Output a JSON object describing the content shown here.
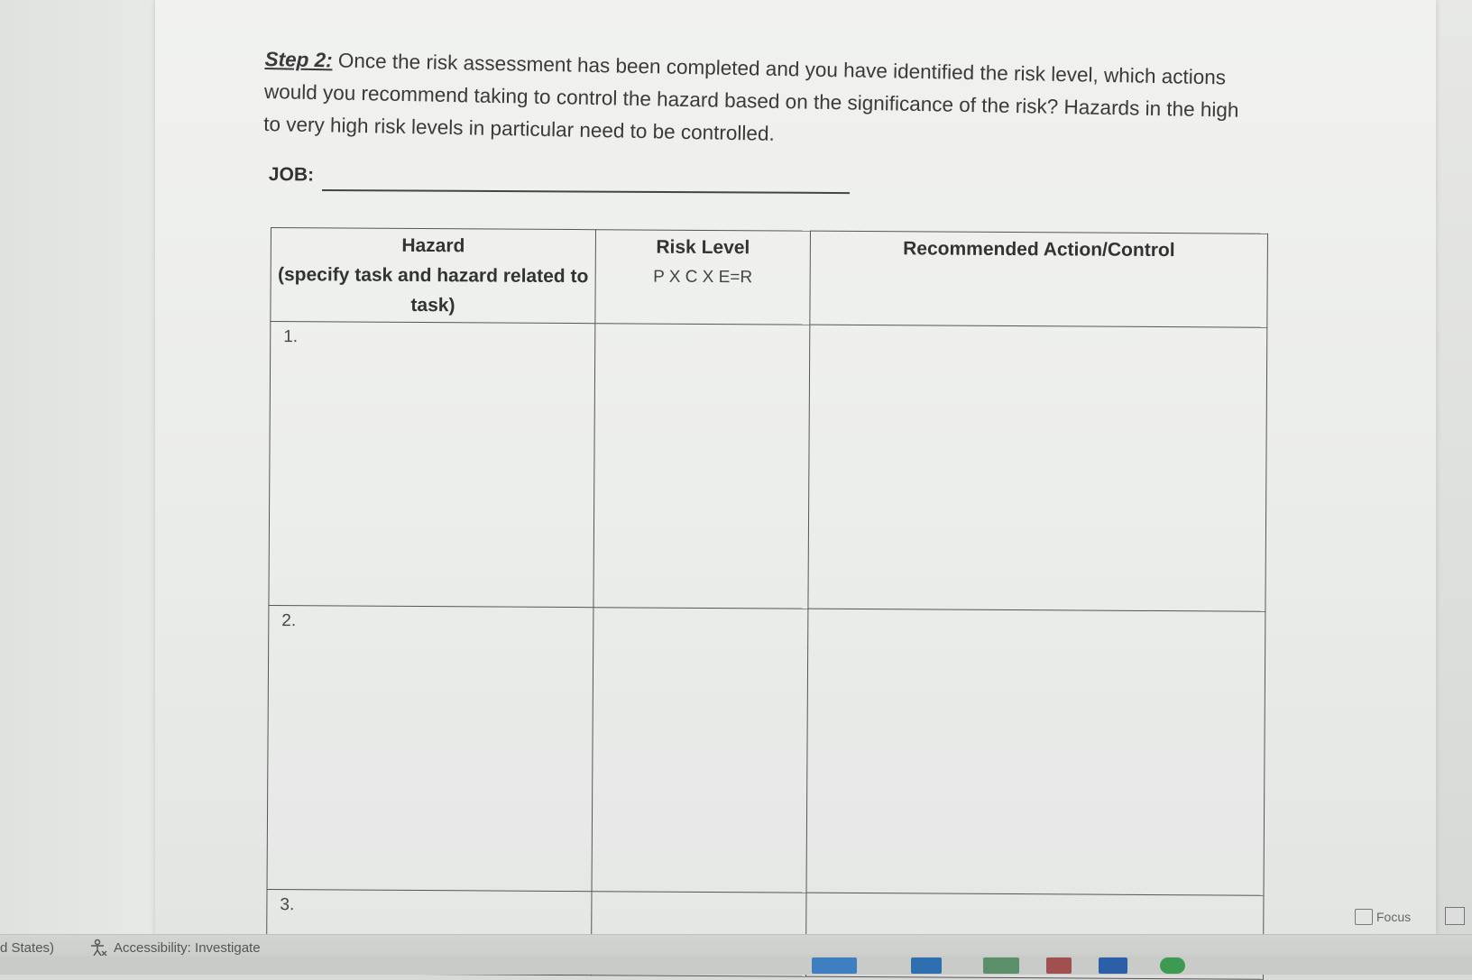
{
  "instructions": {
    "step_label": "Step 2:",
    "text": " Once the risk assessment has been completed and you have identified the risk level, which actions would you recommend taking to control the hazard based on the significance of the risk? Hazards in the high to very high risk levels in particular need to be controlled."
  },
  "job": {
    "label": "JOB:",
    "value": ""
  },
  "table": {
    "headers": {
      "hazard_title": "Hazard",
      "hazard_sub": "(specify task and hazard related to task)",
      "risk_title": "Risk Level",
      "risk_sub": "P X C X E=R",
      "action_title": "Recommended Action/Control"
    },
    "rows": [
      {
        "number": "1.",
        "risk": "",
        "action": ""
      },
      {
        "number": "2.",
        "risk": "",
        "action": ""
      },
      {
        "number": "3.",
        "risk": "",
        "action": ""
      }
    ]
  },
  "statusbar": {
    "language": "d States)",
    "accessibility": "Accessibility: Investigate",
    "focus": "Focus"
  },
  "icons": {
    "accessibility": "accessibility-icon",
    "focus": "focus-icon",
    "view": "print-layout-icon"
  }
}
